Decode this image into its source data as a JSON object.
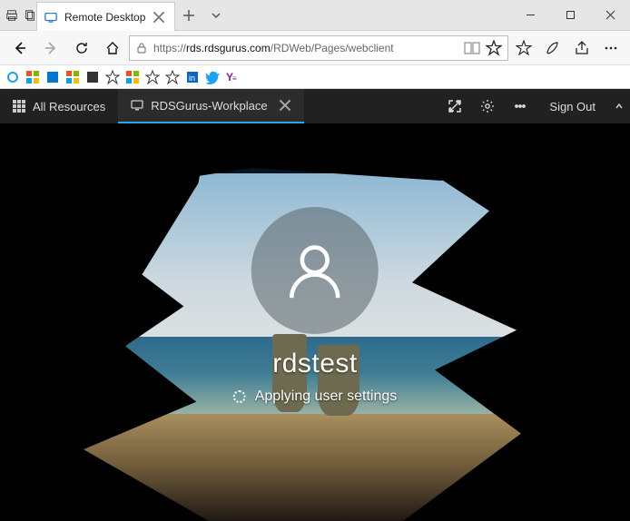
{
  "browser_tab": {
    "title": "Remote Desktop"
  },
  "address_bar": {
    "scheme": "https://",
    "host": "rds.rdsgurus.com",
    "path": "/RDWeb/Pages/webclient"
  },
  "rd_toolbar": {
    "all_resources_label": "All Resources",
    "active_tab_label": "RDSGurus-Workplace",
    "sign_out_label": "Sign Out"
  },
  "login": {
    "username": "rdstest",
    "status": "Applying user settings"
  }
}
